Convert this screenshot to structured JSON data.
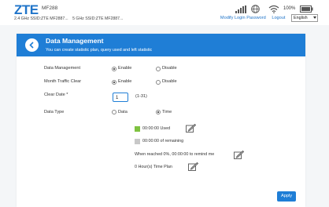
{
  "header": {
    "logo_text": "ZTE",
    "model": "MF288",
    "ssid_24": "2.4 GHz SSID:ZTE MF2887...",
    "ssid_5": "5 GHz SSID:ZTE MF2887...",
    "battery_text": "100%",
    "links": {
      "modify_password": "Modify Login Password",
      "logout": "Logout"
    },
    "language": "English"
  },
  "panel": {
    "title": "Data Management",
    "subtitle": "You can create statistic plan, query used and left statistic"
  },
  "form": {
    "data_management": {
      "label": "Data Management",
      "enable": "Enable",
      "disable": "Disable",
      "selected": "enable"
    },
    "month_clear": {
      "label": "Month Traffic Clear",
      "enable": "Enable",
      "disable": "Disable",
      "selected": "enable"
    },
    "clear_date": {
      "label": "Clear Date *",
      "value": "1",
      "hint": "(1-31)"
    },
    "data_type": {
      "label": "Data Type",
      "data": "Data",
      "time": "Time",
      "selected": "time"
    }
  },
  "stats": {
    "used": "00:00:00 Used",
    "remaining": "00:00:00 of remaining",
    "remind": "When reached 0%, 00:00:00 to remind me",
    "plan": "0 Hour(s) Time Plan",
    "used_color": "#7fc241",
    "remaining_color": "#c8c8c8"
  },
  "apply_label": "Apply",
  "colors": {
    "accent": "#1f7ed6",
    "logo": "#1f74c9"
  }
}
